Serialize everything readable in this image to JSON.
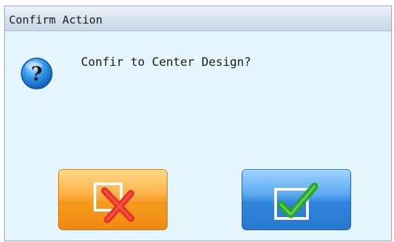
{
  "dialog": {
    "title": "Confirm Action",
    "message": "Confir to Center Design?",
    "icon": "question-icon",
    "buttons": [
      {
        "id": "cancel",
        "icon": "cancel-x-icon",
        "color": "#f59a1e"
      },
      {
        "id": "confirm",
        "icon": "confirm-check-icon",
        "color": "#2f84dc"
      }
    ]
  }
}
